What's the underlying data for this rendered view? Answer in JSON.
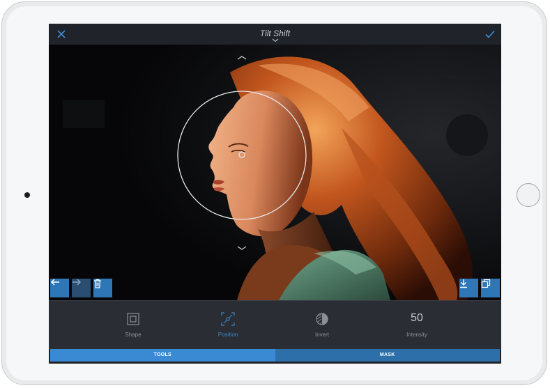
{
  "header": {
    "title": "Tilt Shift"
  },
  "tools": [
    {
      "label": "Shape",
      "icon": "square-shape-icon",
      "active": false
    },
    {
      "label": "Position",
      "icon": "position-icon",
      "active": true
    },
    {
      "label": "Invert",
      "icon": "invert-icon",
      "active": false
    },
    {
      "label": "Intensity",
      "value": "50",
      "active": false
    }
  ],
  "tabs": [
    {
      "label": "TOOLS",
      "active": true
    },
    {
      "label": "MASK",
      "active": false
    }
  ],
  "colors": {
    "accent": "#3a8ad3",
    "button_blue": "#2f76b6",
    "toolbar_bg": "#2a2d33",
    "header_bg": "#202329"
  },
  "canvas_controls": {
    "left": [
      "arrow-left-icon",
      "arrow-right-icon",
      "trash-icon"
    ],
    "right": [
      "download-icon",
      "duplicate-icon"
    ]
  }
}
